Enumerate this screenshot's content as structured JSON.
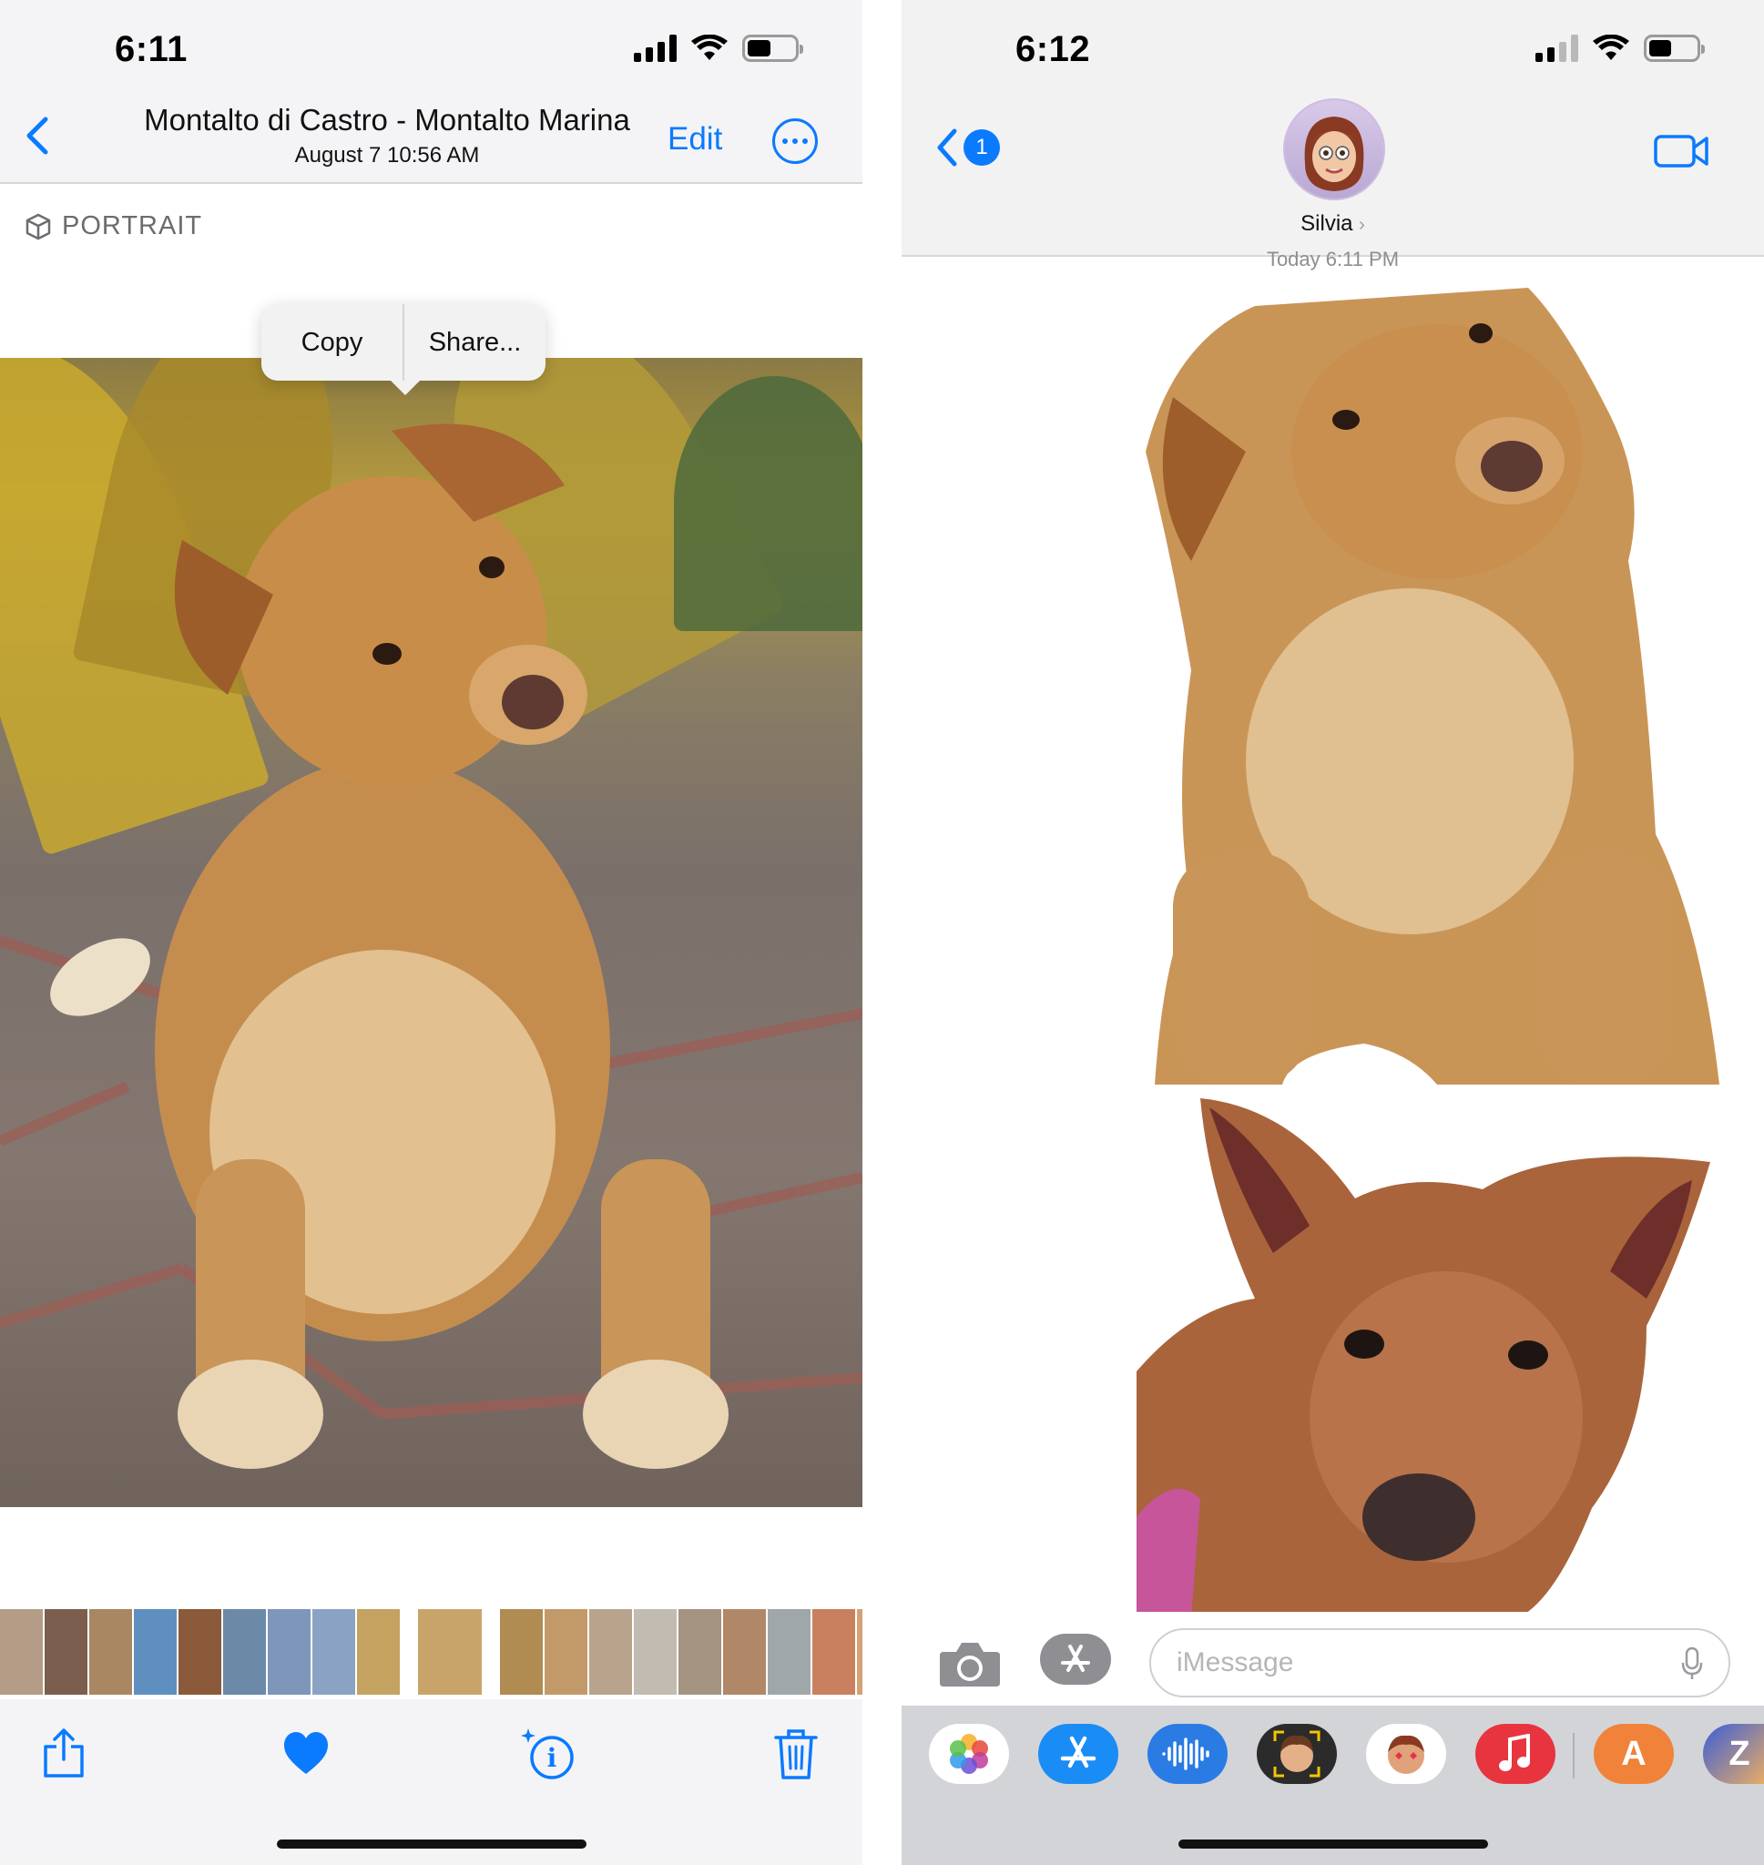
{
  "left": {
    "status": {
      "time": "6:11"
    },
    "nav": {
      "location": "Montalto di Castro - Montalto Marina",
      "date": "August 7  10:56 AM",
      "edit_label": "Edit"
    },
    "badge": "PORTRAIT",
    "popover": {
      "copy": "Copy",
      "share": "Share..."
    },
    "toolbar_icons": [
      "share-icon",
      "heart-icon",
      "info-sparkle-icon",
      "trash-icon"
    ]
  },
  "right": {
    "status": {
      "time": "6:12"
    },
    "back_badge": "1",
    "contact_name": "Silvia",
    "timestamp": "Today 6:11 PM",
    "composer": {
      "placeholder": "iMessage"
    },
    "app_drawer": [
      "photos",
      "app-store",
      "audio",
      "memoji",
      "memoji-stickers",
      "music",
      "a-app",
      "z-app"
    ],
    "app_letters": {
      "a": "A",
      "z": "Z"
    }
  },
  "colors": {
    "accent": "#0a7aff",
    "bar_bg": "#f4f4f6",
    "drawer_bg": "#d3d4d8"
  }
}
